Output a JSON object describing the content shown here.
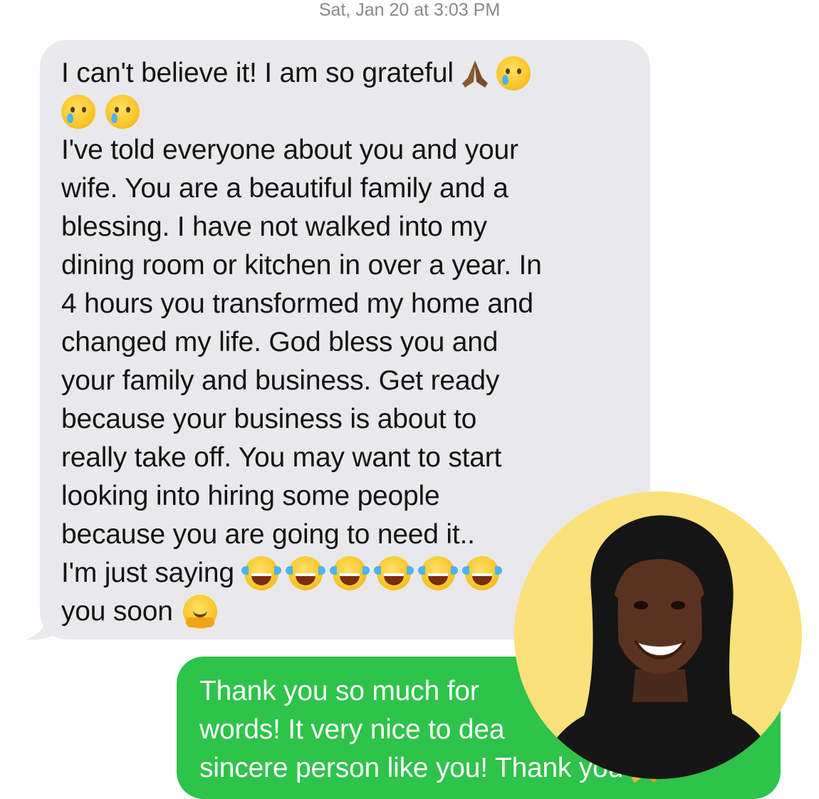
{
  "thread": {
    "timestamp": "Sat, Jan 20 at 3:03 PM"
  },
  "incoming_message": {
    "lines": [
      "I can't believe it! I am so grateful",
      "",
      "I've told everyone about you and your",
      "wife. You are a beautiful family and a",
      "blessing. I have not walked into my",
      "dining room or kitchen in over a year. In",
      "4 hours you transformed my home and",
      "changed my life. God bless you and",
      "your family and business. Get ready",
      "because your business is about to",
      "really take off. You may want to start",
      "looking into hiring some people",
      "because you are going to need it..",
      "I'm just saying",
      "you soon"
    ],
    "emoji": {
      "line1": [
        "folded-hands-icon",
        "face-holding-back-tears-icon"
      ],
      "line2": [
        "face-holding-back-tears-icon",
        "face-holding-back-tears-icon"
      ],
      "line14": [
        "tears-of-joy-icon",
        "tears-of-joy-icon",
        "tears-of-joy-icon",
        "tears-of-joy-icon",
        "tears-of-joy-icon",
        "tears-of-joy-icon"
      ],
      "line15": [
        "hugging-face-icon"
      ]
    },
    "bubble_color": "#e9e9eb"
  },
  "outgoing_message": {
    "lines": [
      "Thank you so much for",
      "words! It very nice to dea",
      "sincere person like you! Thank you"
    ],
    "emoji": [
      "folded-hands-icon"
    ],
    "bubble_color": "#2ec34a"
  },
  "avatar": {
    "background_color": "#fbe17a"
  }
}
